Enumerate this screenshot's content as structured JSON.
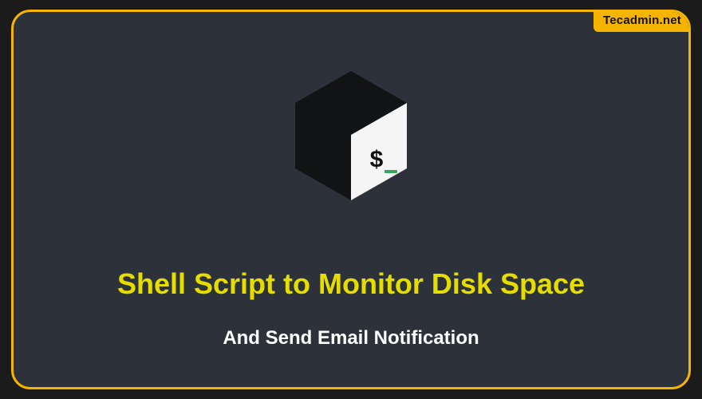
{
  "brand": {
    "watermark": "Tecadmin.net"
  },
  "headline": {
    "title": "Shell Script to Monitor Disk Space",
    "subtitle": "And Send Email Notification"
  },
  "icon": {
    "name": "terminal-cube-icon",
    "prompt_symbol": "$",
    "cursor_color": "#3ba55d"
  },
  "colors": {
    "accent": "#f5b400",
    "title": "#e6dd00",
    "subtitle": "#ffffff",
    "background": "#2c313a"
  }
}
